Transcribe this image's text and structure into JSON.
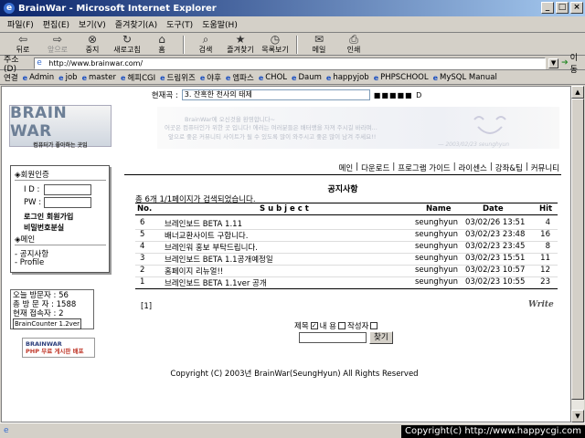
{
  "window": {
    "title": "BrainWar - Microsoft Internet Explorer"
  },
  "menu": [
    "파일(F)",
    "편집(E)",
    "보기(V)",
    "즐겨찾기(A)",
    "도구(T)",
    "도움말(H)"
  ],
  "toolbar": {
    "back": "뒤로",
    "forward": "앞으로",
    "stop": "중지",
    "refresh": "새로고침",
    "home": "홈",
    "search": "검색",
    "favorites": "즐겨찾기",
    "history": "목록보기",
    "mail": "메일",
    "print": "인쇄"
  },
  "address": {
    "label": "주소(D)",
    "url": "http://www.brainwar.com/",
    "go": "이동"
  },
  "links": {
    "label": "연결",
    "items": [
      "Admin",
      "job",
      "master",
      "헤피CGI",
      "드림위즈",
      "야후",
      "엠파스",
      "CHOL",
      "Daum",
      "happyjob",
      "PHPSCHOOL",
      "MySQL Manual"
    ]
  },
  "music": {
    "label": "현재곡 :",
    "song": "3. 잔혹한 천사의 태제",
    "controls": "■■■■■ D"
  },
  "logo": {
    "title": "BRAIN WAR",
    "subtitle": "컴퓨터가 좋아하는 곳임"
  },
  "banner": {
    "line1": "BrainWar에 오신것을 환영합니다~",
    "line2": "어곳은 컴퓨터인가 위한 곳 입니다! 에러는 여러분들은 배터랭을 자져 주시길 바라며...",
    "line3": "앞으로 좋은 커뮤니티 사이트가 될 수 있도록 많이 와주시고 좋은 많이 남겨 주세요!!",
    "signature": "― 2003/02/23 seunghyun"
  },
  "member": {
    "header": "◈회원인증",
    "id_label": "I D :",
    "pw_label": "PW :",
    "login_join": "로그인 회원가입",
    "lost_pw": "비밀번호분실",
    "menu_header": "◈메인",
    "menu_items": [
      "- 공지사항",
      "- Profile"
    ]
  },
  "counter": {
    "today": "오늘 방문자 : 56",
    "total": "총  방 문 자 : 1588",
    "online": "현재 접속자 : 2",
    "version": "BrainCounter 1.2ver"
  },
  "badge": {
    "line1": "BRAINWAR",
    "line2": "PHP 무료 게시판 배포"
  },
  "topnav": [
    "메인",
    "다운로드",
    "프로그램 가이드",
    "라이센스",
    "강좌&팁",
    "커뮤니티"
  ],
  "board": {
    "title": "공지사항",
    "count_text": "총 6개  1/1페이지가 검색되었습니다.",
    "headers": {
      "no": "No.",
      "subject": "S u b j e c t",
      "name": "Name",
      "date": "Date",
      "hit": "Hit"
    },
    "rows": [
      {
        "no": "6",
        "subject": "브레인보드 BETA 1.11",
        "name": "seunghyun",
        "date": "03/02/26 13:51",
        "hit": "4"
      },
      {
        "no": "5",
        "subject": "배너교환사이트 구합니다.",
        "name": "seunghyun",
        "date": "03/02/23 23:48",
        "hit": "16"
      },
      {
        "no": "4",
        "subject": "브레인워 홍보 부탁드립니다.",
        "name": "seunghyun",
        "date": "03/02/23 23:45",
        "hit": "8"
      },
      {
        "no": "3",
        "subject": "브레인보드 BETA 1.1공개예정일",
        "name": "seunghyun",
        "date": "03/02/23 15:51",
        "hit": "11"
      },
      {
        "no": "2",
        "subject": "홈페이지 리뉴얼!!",
        "name": "seunghyun",
        "date": "03/02/23 10:57",
        "hit": "12"
      },
      {
        "no": "1",
        "subject": "브레인보드 BETA 1.1ver 공개",
        "name": "seunghyun",
        "date": "03/02/23 10:55",
        "hit": "23"
      }
    ],
    "pager": "[1]",
    "write": "Write"
  },
  "search": {
    "subject_label": "제목",
    "content_label": "내  용",
    "author_label": "작성자",
    "button": "찾기"
  },
  "footer": "Copyright (C) 2003년 BrainWar(SeungHyun) All Rights Reserved",
  "status": {
    "copyright": "Copyright(c) http://www.happycgi.com"
  }
}
